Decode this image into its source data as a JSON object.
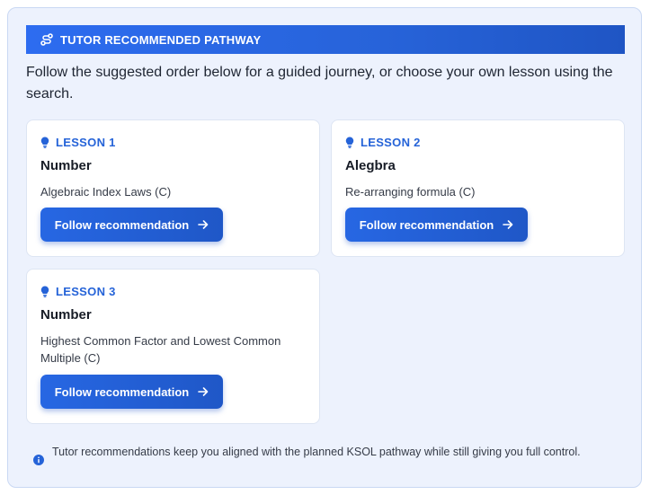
{
  "banner": {
    "icon": "route-icon",
    "title": "TUTOR RECOMMENDED PATHWAY"
  },
  "intro": "Follow the suggested order below for a guided journey, or choose your own lesson using the search.",
  "lessons": [
    {
      "tag": "LESSON 1",
      "topic": "Number",
      "description": "Algebraic Index Laws (C)",
      "button_label": "Follow recommendation"
    },
    {
      "tag": "LESSON 2",
      "topic": "Alegbra",
      "description": "Re-arranging formula (C)",
      "button_label": "Follow recommendation"
    },
    {
      "tag": "LESSON 3",
      "topic": "Number",
      "description": "Highest Common Factor and Lowest Common Multiple (C)",
      "button_label": "Follow recommendation"
    }
  ],
  "footnote": {
    "icon": "info-icon",
    "text": "Tutor recommendations keep you aligned with the planned KSOL pathway while still giving you full control."
  },
  "colors": {
    "accent": "#2563d8",
    "panel_bg": "#edf2fd",
    "banner_bg": "#2763d9"
  }
}
